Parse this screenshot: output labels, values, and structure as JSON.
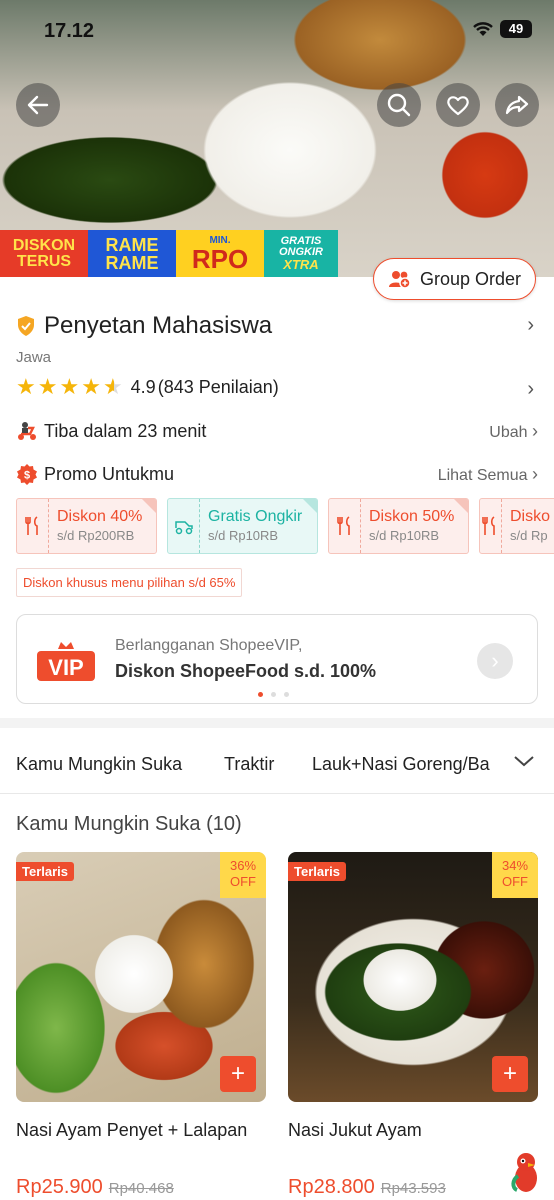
{
  "status_bar": {
    "time": "17.12",
    "battery": "49"
  },
  "promo_strip": {
    "tiles": [
      {
        "line1": "DISKON",
        "line2": "TERUS"
      },
      {
        "line1": "RAME",
        "line2": "RAME"
      },
      {
        "small": "MIN.",
        "big": "RPO"
      },
      {
        "line1": "GRATIS",
        "line2": "ONGKIR",
        "line3": "XTRA"
      }
    ]
  },
  "group_order_label": "Group Order",
  "store": {
    "name": "Penyetan Mahasiswa",
    "region": "Jawa",
    "rating": "4.9",
    "rating_count": "(843 Penilaian)"
  },
  "delivery": {
    "label": "Tiba dalam 23 menit",
    "action": "Ubah"
  },
  "promo": {
    "label": "Promo Untukmu",
    "action": "Lihat Semua"
  },
  "vouchers": [
    {
      "title": "Diskon 40%",
      "sub": "s/d Rp200RB",
      "style": "red"
    },
    {
      "title": "Gratis Ongkir",
      "sub": "s/d Rp10RB",
      "style": "green"
    },
    {
      "title": "Diskon 50%",
      "sub": "s/d Rp10RB",
      "style": "red"
    },
    {
      "title": "Disko",
      "sub": "s/d Rp",
      "style": "red"
    }
  ],
  "special_note": "Diskon khusus menu pilihan s/d 65%",
  "vip": {
    "logo": "VIP",
    "line1": "Berlangganan ShopeeVIP,",
    "line2": "Diskon ShopeeFood s.d. 100%"
  },
  "category_tabs": [
    "Kamu Mungkin Suka",
    "Traktir",
    "Lauk+Nasi Goreng/Ba"
  ],
  "section_title": "Kamu Mungkin Suka (10)",
  "products": [
    {
      "tag": "Terlaris",
      "off_pct": "36%",
      "off_label": "OFF",
      "name": "Nasi Ayam Penyet + Lalapan",
      "price": "Rp25.900",
      "old_price": "Rp40.468"
    },
    {
      "tag": "Terlaris",
      "off_pct": "34%",
      "off_label": "OFF",
      "name": "Nasi Jukut Ayam",
      "price": "Rp28.800",
      "old_price": "Rp43.593"
    }
  ],
  "colors": {
    "accent": "#ee4d2d",
    "star": "#f5b50a",
    "teal": "#1cb3a2"
  },
  "icons": [
    "back-icon",
    "search-icon",
    "heart-icon",
    "share-icon",
    "group-icon",
    "verified-shield-icon",
    "scooter-icon",
    "promo-icon",
    "chevron-right-icon",
    "chevron-down-icon",
    "cutlery-icon",
    "delivery-truck-icon",
    "plus-icon"
  ]
}
